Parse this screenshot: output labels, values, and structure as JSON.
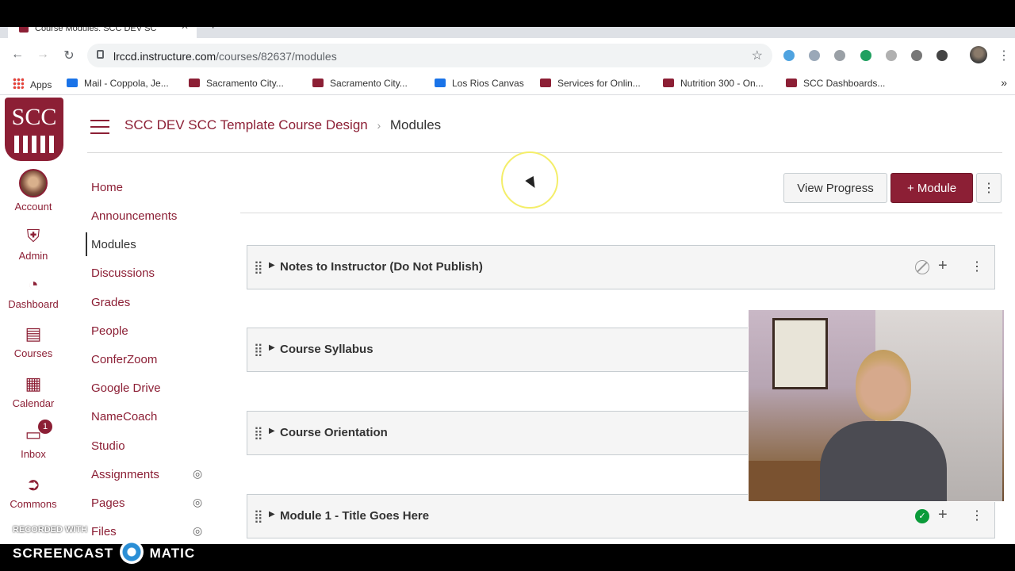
{
  "browser": {
    "tab_title": "Course Modules: SCC DEV SC",
    "url_host": "lrccd.instructure.com",
    "url_path": "/courses/82637/modules",
    "bookmarks": [
      {
        "label": "Apps"
      },
      {
        "label": "Mail - Coppola, Je..."
      },
      {
        "label": "Sacramento City..."
      },
      {
        "label": "Sacramento City..."
      },
      {
        "label": "Los Rios Canvas"
      },
      {
        "label": "Services for Onlin..."
      },
      {
        "label": "Nutrition 300 - On..."
      },
      {
        "label": "SCC Dashboards..."
      }
    ]
  },
  "global_nav": {
    "logo_text": "SCC",
    "items": [
      {
        "label": "Account"
      },
      {
        "label": "Admin"
      },
      {
        "label": "Dashboard"
      },
      {
        "label": "Courses"
      },
      {
        "label": "Calendar"
      },
      {
        "label": "Inbox",
        "badge": "1"
      },
      {
        "label": "Commons"
      }
    ]
  },
  "header": {
    "course_name": "SCC DEV SCC Template Course Design",
    "separator": "›",
    "current_page": "Modules"
  },
  "course_nav": {
    "items": [
      {
        "label": "Home"
      },
      {
        "label": "Announcements"
      },
      {
        "label": "Modules",
        "active": true
      },
      {
        "label": "Discussions"
      },
      {
        "label": "Grades"
      },
      {
        "label": "People"
      },
      {
        "label": "ConferZoom"
      },
      {
        "label": "Google Drive"
      },
      {
        "label": "NameCoach"
      },
      {
        "label": "Studio"
      },
      {
        "label": "Assignments",
        "hidden_from_students": true
      },
      {
        "label": "Pages",
        "hidden_from_students": true
      },
      {
        "label": "Files",
        "hidden_from_students": true
      }
    ]
  },
  "toolbar": {
    "view_progress_label": "View Progress",
    "add_module_label": "+ Module"
  },
  "modules": [
    {
      "title": "Notes to Instructor (Do Not Publish)",
      "status": "unpublished"
    },
    {
      "title": "Course Syllabus"
    },
    {
      "title": "Course Orientation"
    },
    {
      "title": "Module 1 - Title Goes Here",
      "status": "published"
    }
  ],
  "watermark": {
    "recorded_with": "RECORDED WITH",
    "brand_left": "SCREENCAST",
    "brand_right": "MATIC"
  },
  "colors": {
    "brand": "#8c1f35",
    "published": "#0b9b3a"
  }
}
